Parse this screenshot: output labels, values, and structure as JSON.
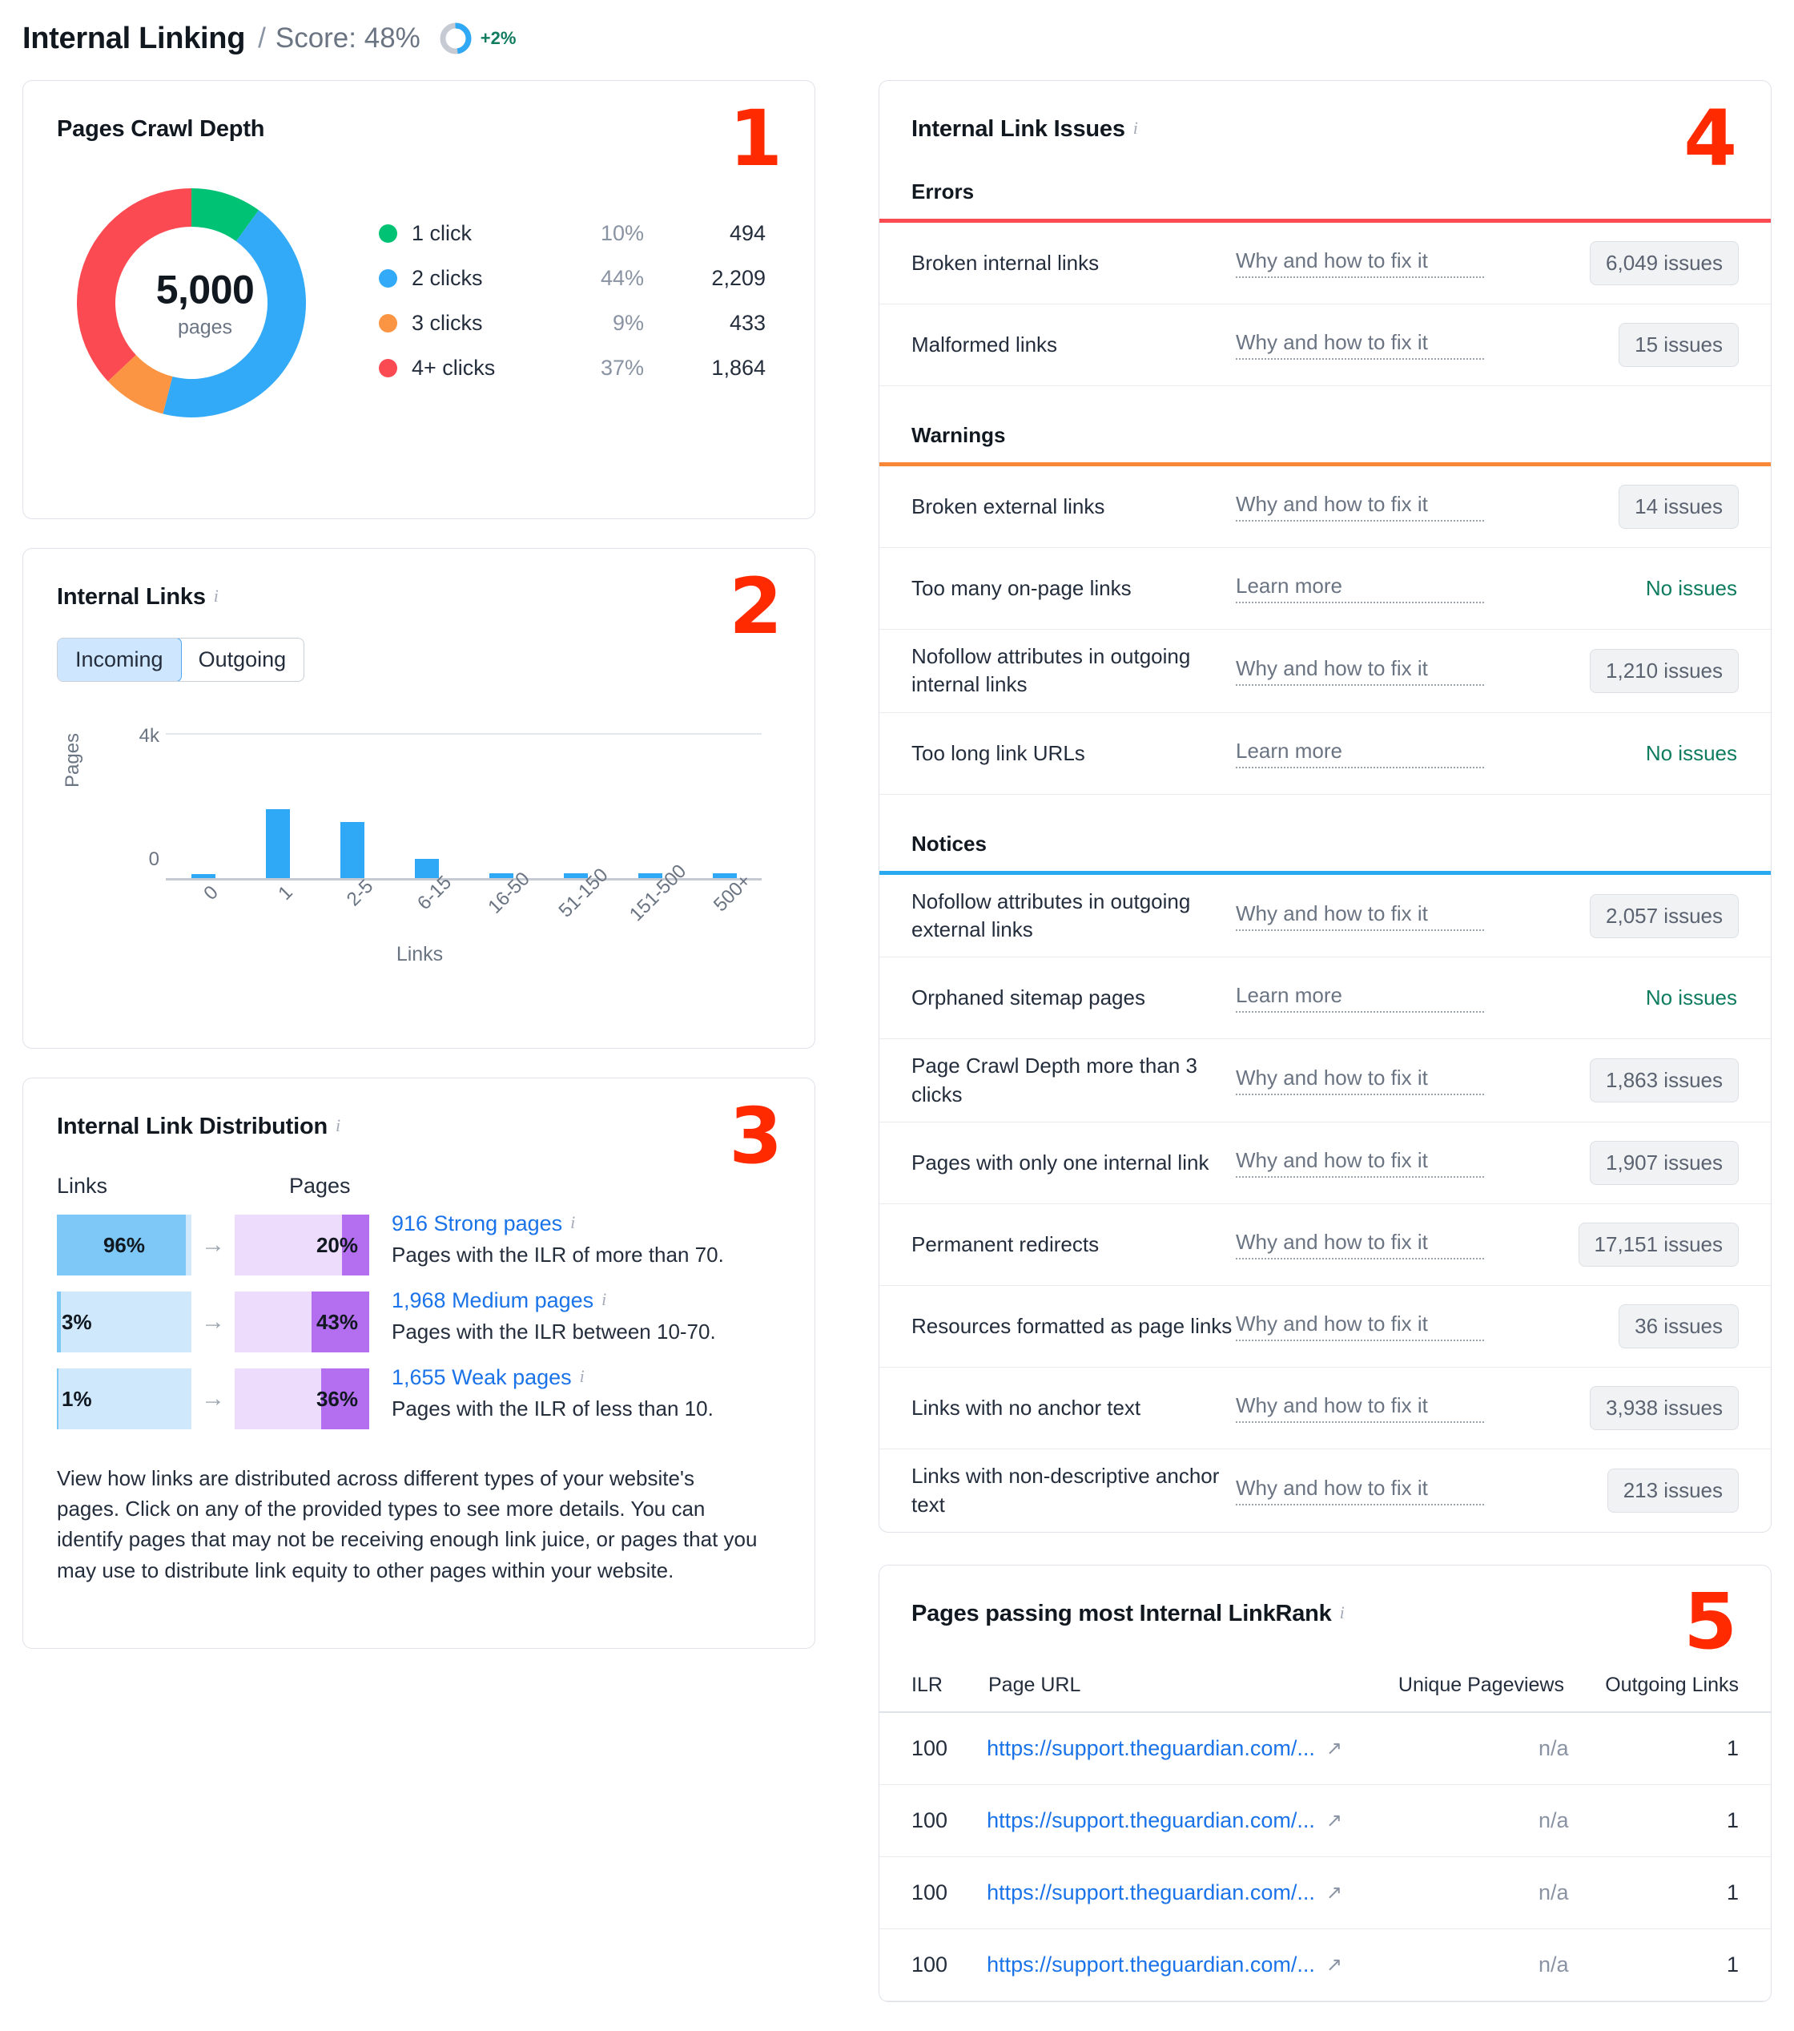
{
  "header": {
    "title": "Internal Linking",
    "separator": "/",
    "score_label": "Score: 48%",
    "delta": "+2%",
    "score_value": 48,
    "donut_accent": "#2fa8f5",
    "donut_track": "#c6cbd3"
  },
  "crawl": {
    "title": "Pages Crawl Depth",
    "badge": "1",
    "total": "5,000",
    "total_sub": "pages",
    "legend": [
      {
        "label": "1 click",
        "pct": "10%",
        "value": "494",
        "color": "#00c274"
      },
      {
        "label": "2 clicks",
        "pct": "44%",
        "value": "2,209",
        "color": "#33aaf7"
      },
      {
        "label": "3 clicks",
        "pct": "9%",
        "value": "433",
        "color": "#fb9543"
      },
      {
        "label": "4+ clicks",
        "pct": "37%",
        "value": "1,864",
        "color": "#fb4a52"
      }
    ]
  },
  "links": {
    "title": "Internal Links",
    "badge": "2",
    "toggle": {
      "incoming": "Incoming",
      "outgoing": "Outgoing",
      "selected": "Incoming"
    }
  },
  "distribution": {
    "title": "Internal Link Distribution",
    "badge": "3",
    "col_links": "Links",
    "col_pages": "Pages",
    "arrow": "→",
    "rows": [
      {
        "links_pct": "96%",
        "links_val": 96,
        "pages_pct": "20%",
        "pages_val": 20,
        "name": "916 Strong pages",
        "desc": "Pages with the ILR of more than 70."
      },
      {
        "links_pct": "3%",
        "links_val": 3,
        "pages_pct": "43%",
        "pages_val": 43,
        "name": "1,968 Medium pages",
        "desc": "Pages with the ILR between 10-70."
      },
      {
        "links_pct": "1%",
        "links_val": 1,
        "pages_pct": "36%",
        "pages_val": 36,
        "name": "1,655 Weak pages",
        "desc": "Pages with the ILR of less than 10."
      }
    ],
    "note": "View how links are distributed across different types of your website's pages. Click on any of the provided types to see more details. You can identify pages that may not be receiving enough link juice, or pages that you may use to distribute link equity to other pages within your website."
  },
  "issues": {
    "title": "Internal Link Issues",
    "badge": "4",
    "groups": [
      {
        "name": "Errors",
        "color": "#fb4a52",
        "rows": [
          {
            "name": "Broken internal links",
            "link": "Why and how to fix it",
            "value": "6,049 issues",
            "has_issues": true
          },
          {
            "name": "Malformed links",
            "link": "Why and how to fix it",
            "value": "15 issues",
            "has_issues": true
          }
        ]
      },
      {
        "name": "Warnings",
        "color": "#f98737",
        "rows": [
          {
            "name": "Broken external links",
            "link": "Why and how to fix it",
            "value": "14 issues",
            "has_issues": true
          },
          {
            "name": "Too many on-page links",
            "link": "Learn more",
            "value": "No issues",
            "has_issues": false
          },
          {
            "name": "Nofollow attributes in outgoing internal links",
            "link": "Why and how to fix it",
            "value": "1,210 issues",
            "has_issues": true
          },
          {
            "name": "Too long link URLs",
            "link": "Learn more",
            "value": "No issues",
            "has_issues": false
          }
        ]
      },
      {
        "name": "Notices",
        "color": "#28a9f0",
        "rows": [
          {
            "name": "Nofollow attributes in outgoing external links",
            "link": "Why and how to fix it",
            "value": "2,057 issues",
            "has_issues": true
          },
          {
            "name": "Orphaned sitemap pages",
            "link": "Learn more",
            "value": "No issues",
            "has_issues": false
          },
          {
            "name": "Page Crawl Depth more than 3 clicks",
            "link": "Why and how to fix it",
            "value": "1,863 issues",
            "has_issues": true
          },
          {
            "name": "Pages with only one internal link",
            "link": "Why and how to fix it",
            "value": "1,907 issues",
            "has_issues": true
          },
          {
            "name": "Permanent redirects",
            "link": "Why and how to fix it",
            "value": "17,151 issues",
            "has_issues": true
          },
          {
            "name": "Resources formatted as page links",
            "link": "Why and how to fix it",
            "value": "36 issues",
            "has_issues": true
          },
          {
            "name": "Links with no anchor text",
            "link": "Why and how to fix it",
            "value": "3,938 issues",
            "has_issues": true
          },
          {
            "name": "Links with non-descriptive anchor text",
            "link": "Why and how to fix it",
            "value": "213 issues",
            "has_issues": true
          }
        ]
      }
    ]
  },
  "ilr_table": {
    "title": "Pages passing most Internal LinkRank",
    "badge": "5",
    "columns": {
      "ilr": "ILR",
      "url": "Page URL",
      "pageviews": "Unique Pageviews",
      "outgoing": "Outgoing Links"
    },
    "rows": [
      {
        "ilr": "100",
        "url": "https://support.theguardian.com/...",
        "pageviews": "n/a",
        "outgoing": "1"
      },
      {
        "ilr": "100",
        "url": "https://support.theguardian.com/...",
        "pageviews": "n/a",
        "outgoing": "1"
      },
      {
        "ilr": "100",
        "url": "https://support.theguardian.com/...",
        "pageviews": "n/a",
        "outgoing": "1"
      },
      {
        "ilr": "100",
        "url": "https://support.theguardian.com/...",
        "pageviews": "n/a",
        "outgoing": "1"
      }
    ]
  },
  "chart_data": [
    {
      "type": "pie",
      "title": "Pages Crawl Depth",
      "center_label": "5,000 pages",
      "total": 5000,
      "categories": [
        "1 click",
        "2 clicks",
        "3 clicks",
        "4+ clicks"
      ],
      "values": [
        494,
        2209,
        433,
        1864
      ],
      "percents": [
        10,
        44,
        9,
        37
      ],
      "colors": [
        "#00c274",
        "#33aaf7",
        "#fb9543",
        "#fb4a52"
      ],
      "legend": "right",
      "donut": true
    },
    {
      "type": "bar",
      "title": "Internal Links",
      "series_name": "Incoming",
      "categories": [
        "0",
        "1",
        "2-5",
        "6-15",
        "16-50",
        "51-150",
        "151-500",
        "500+"
      ],
      "values": [
        120,
        1900,
        1550,
        520,
        125,
        125,
        130,
        125
      ],
      "xlabel": "Links",
      "ylabel": "Pages",
      "ylim": [
        0,
        4000
      ],
      "yticks": [
        "0",
        "4k"
      ],
      "grid": true,
      "bar_color": "#2fa8f5"
    },
    {
      "type": "bar",
      "title": "Internal Link Distribution",
      "orientation": "horizontal",
      "categories": [
        "916 Strong pages",
        "1,968 Medium pages",
        "1,655 Weak pages"
      ],
      "series": [
        {
          "name": "Links",
          "values": [
            96,
            3,
            1
          ]
        },
        {
          "name": "Pages",
          "values": [
            20,
            43,
            36
          ]
        }
      ],
      "ylim": [
        0,
        100
      ],
      "colors": [
        "#7ec8f7",
        "#b46ef0"
      ]
    }
  ]
}
